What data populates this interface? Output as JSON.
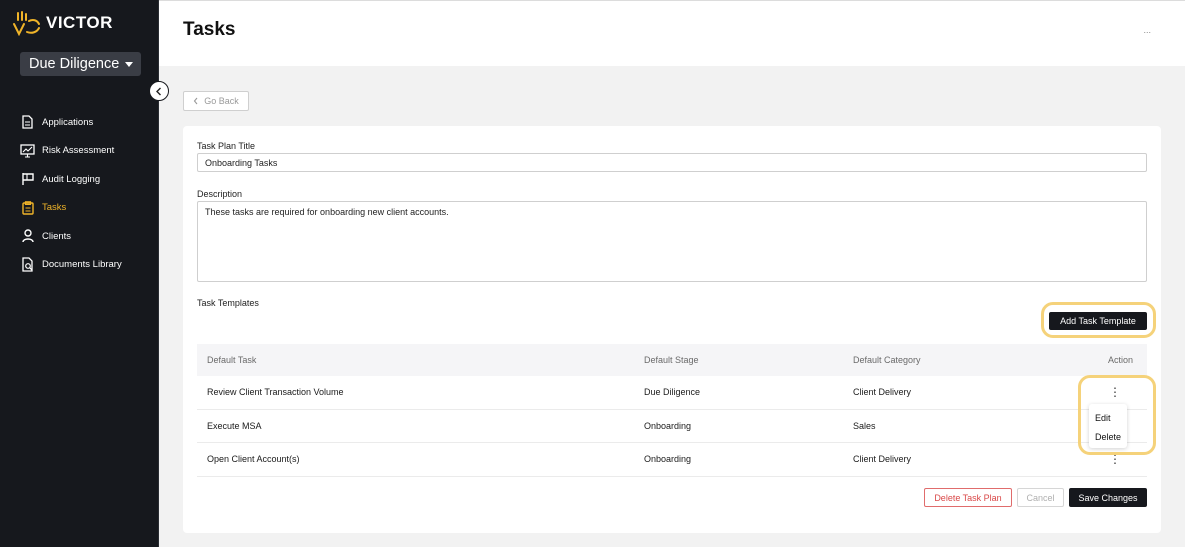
{
  "app": {
    "brand": "VICTOR"
  },
  "sidebar": {
    "module": "Due Diligence",
    "items": [
      {
        "label": "Applications",
        "icon": "document-icon",
        "active": false
      },
      {
        "label": "Risk Assessment",
        "icon": "presentation-chart-icon",
        "active": false
      },
      {
        "label": "Audit Logging",
        "icon": "flag-icon",
        "active": false
      },
      {
        "label": "Tasks",
        "icon": "clipboard-icon",
        "active": true
      },
      {
        "label": "Clients",
        "icon": "user-icon",
        "active": false
      },
      {
        "label": "Documents Library",
        "icon": "document-search-icon",
        "active": false
      }
    ]
  },
  "header": {
    "title": "Tasks",
    "more": "..."
  },
  "go_back": "Go Back",
  "form": {
    "title_label": "Task Plan Title",
    "title_value": "Onboarding Tasks",
    "description_label": "Description",
    "description_value": "These tasks are required for onboarding new client accounts.",
    "templates_label": "Task Templates",
    "add_button": "Add Task Template"
  },
  "table": {
    "headers": [
      "Default Task",
      "Default Stage",
      "Default Category",
      "Action"
    ],
    "rows": [
      {
        "task": "Review Client Transaction Volume",
        "stage": "Due Diligence",
        "category": "Client Delivery"
      },
      {
        "task": "Execute MSA",
        "stage": "Onboarding",
        "category": "Sales"
      },
      {
        "task": "Open Client Account(s)",
        "stage": "Onboarding",
        "category": "Client Delivery"
      }
    ],
    "kebab": "⋮"
  },
  "action_menu": {
    "edit": "Edit",
    "delete": "Delete"
  },
  "footer": {
    "delete_plan": "Delete Task Plan",
    "cancel": "Cancel",
    "save": "Save Changes"
  },
  "colors": {
    "sidebar_bg": "#16181d",
    "accent": "#f0b429",
    "highlight": "#f5d27a",
    "danger": "#d94848"
  }
}
